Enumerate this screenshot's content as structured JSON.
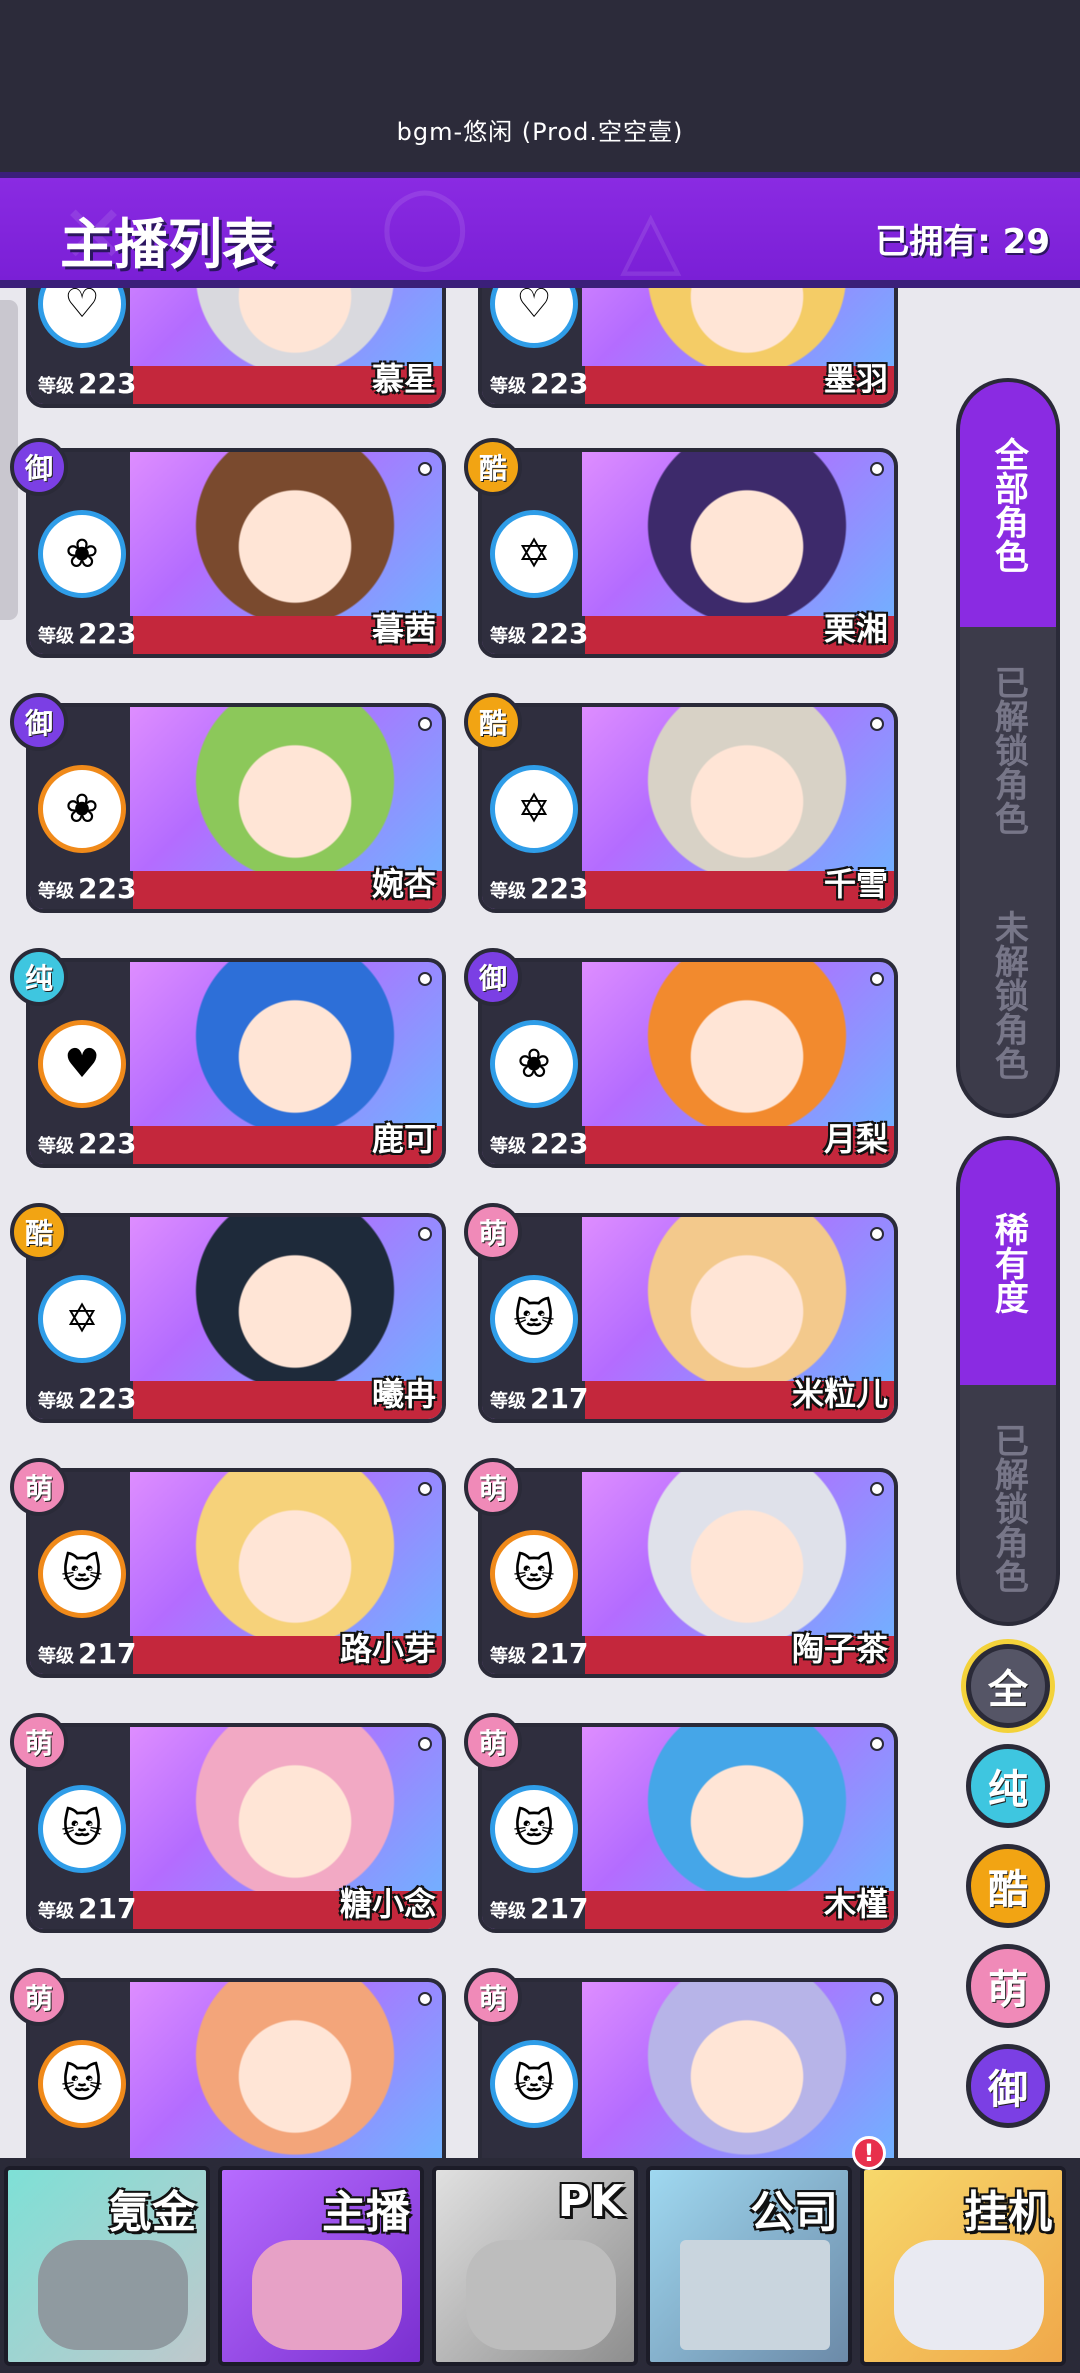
{
  "topbar": {
    "bgm": "bgm-悠闲 (Prod.空空壹)"
  },
  "header": {
    "title": "主播列表",
    "owned": "已拥有: 29"
  },
  "cards": [
    {
      "name": "慕星",
      "level": "223",
      "badge": "",
      "level_label": "等级"
    },
    {
      "name": "墨羽",
      "level": "223",
      "badge": "",
      "level_label": "等级"
    },
    {
      "name": "暮茜",
      "level": "223",
      "badge": "御",
      "level_label": "等级"
    },
    {
      "name": "栗湘",
      "level": "223",
      "badge": "酷",
      "level_label": "等级"
    },
    {
      "name": "婉杏",
      "level": "223",
      "badge": "御",
      "level_label": "等级"
    },
    {
      "name": "千雪",
      "level": "223",
      "badge": "酷",
      "level_label": "等级"
    },
    {
      "name": "鹿可",
      "level": "223",
      "badge": "纯",
      "level_label": "等级"
    },
    {
      "name": "月梨",
      "level": "223",
      "badge": "御",
      "level_label": "等级"
    },
    {
      "name": "曦冉",
      "level": "223",
      "badge": "酷",
      "level_label": "等级"
    },
    {
      "name": "米粒儿",
      "level": "217",
      "badge": "萌",
      "level_label": "等级"
    },
    {
      "name": "路小芽",
      "level": "217",
      "badge": "萌",
      "level_label": "等级"
    },
    {
      "name": "陶子茶",
      "level": "217",
      "badge": "萌",
      "level_label": "等级"
    },
    {
      "name": "糖小念",
      "level": "217",
      "badge": "萌",
      "level_label": "等级"
    },
    {
      "name": "木槿",
      "level": "217",
      "badge": "萌",
      "level_label": "等级"
    },
    {
      "name": "",
      "level": "",
      "badge": "萌",
      "level_label": ""
    },
    {
      "name": "",
      "level": "",
      "badge": "萌",
      "level_label": ""
    }
  ],
  "filters": {
    "roles": [
      "全部角色",
      "已解锁角色",
      "未解锁角色"
    ],
    "rarity_group": [
      "稀有度",
      "已解锁角色"
    ],
    "rarity_circles": [
      "全",
      "纯",
      "酷",
      "萌",
      "御"
    ]
  },
  "nav": {
    "tabs": [
      "氪金",
      "主播",
      "PK",
      "公司",
      "挂机"
    ],
    "notice": "!"
  },
  "colors": {
    "purple": "#8a2be2",
    "badge_御": "#7b3fe4",
    "badge_酷": "#f2a413",
    "badge_纯": "#3ec6e0",
    "badge_萌": "#f08ab8",
    "badge_全": "#555566"
  }
}
